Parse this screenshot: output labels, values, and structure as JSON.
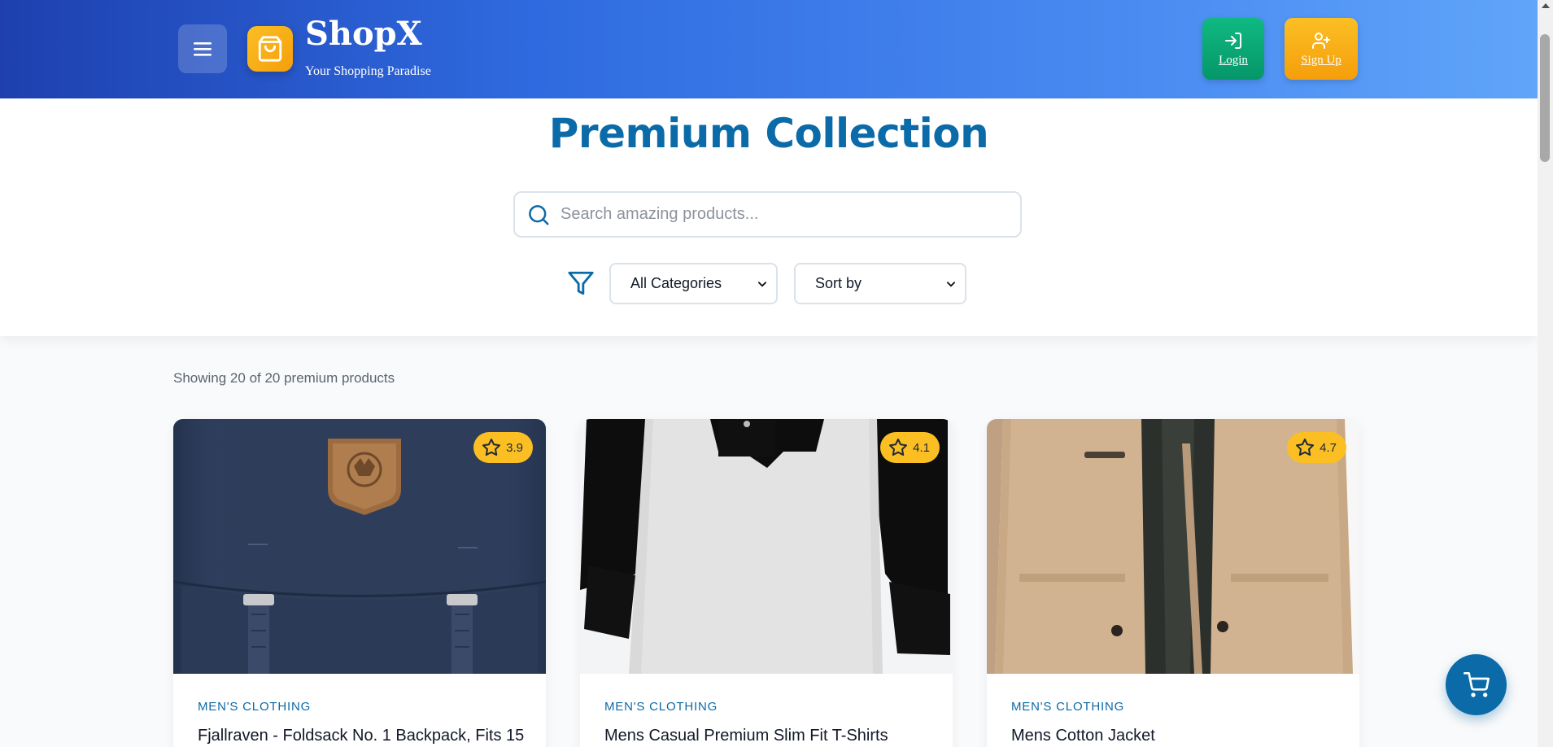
{
  "header": {
    "brand_name": "ShopX",
    "brand_tagline": "Your Shopping Paradise",
    "menu_icon": "hamburger-menu-icon",
    "logo_icon": "shopping-bag-icon",
    "login_label": "Login",
    "login_icon": "login-arrow-icon",
    "signup_label": "Sign Up",
    "signup_icon": "user-plus-icon",
    "colors": {
      "gradient_start": "#1e40af",
      "gradient_end": "#60a5fa",
      "login_bg": "#10b981",
      "signup_bg": "#fbbf24"
    }
  },
  "hero": {
    "title": "Premium Collection",
    "search": {
      "placeholder": "Search amazing products...",
      "value": "",
      "icon": "search-icon"
    },
    "filter_icon": "filter-funnel-icon",
    "category_select": {
      "selected": "All Categories"
    },
    "sort_select": {
      "selected": "Sort by"
    }
  },
  "results": {
    "showing_text": "Showing 20 of 20 premium products"
  },
  "products": [
    {
      "rating": "3.9",
      "category": "MEN'S CLOTHING",
      "title": "Fjallraven - Foldsack No. 1 Backpack, Fits 15",
      "image": "navy backpack"
    },
    {
      "rating": "4.1",
      "category": "MEN'S CLOTHING",
      "title": "Mens Casual Premium Slim Fit T-Shirts",
      "image": "raglan t-shirt"
    },
    {
      "rating": "4.7",
      "category": "MEN'S CLOTHING",
      "title": "Mens Cotton Jacket",
      "image": "khaki cotton jacket"
    }
  ],
  "cart": {
    "icon": "shopping-cart-icon"
  },
  "colors": {
    "accent": "#0b6aa8",
    "rating_badge": "#fbbf24"
  }
}
